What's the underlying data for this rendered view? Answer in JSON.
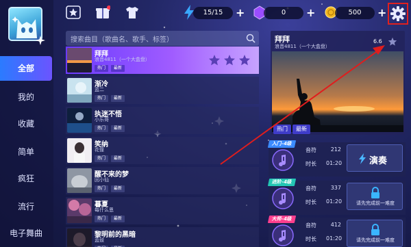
{
  "top_bar": {
    "energy": "15/15",
    "gems": "0",
    "coins": "500"
  },
  "sidebar": {
    "items": [
      {
        "label": "全部"
      },
      {
        "label": "我的"
      },
      {
        "label": "收藏"
      },
      {
        "label": "简单"
      },
      {
        "label": "疯狂"
      },
      {
        "label": "流行"
      },
      {
        "label": "电子舞曲"
      }
    ]
  },
  "search": {
    "placeholder": "搜索曲目（歌曲名、歌手、标签）"
  },
  "songs": [
    {
      "title": "拜拜",
      "artist": "浪音4811（一个大盒盘）",
      "tags": [
        "热门",
        "最新"
      ]
    },
    {
      "title": "渐冷",
      "artist": "蓝二",
      "tags": [
        "热门",
        "最新"
      ]
    },
    {
      "title": "执迷不悟",
      "artist": "小乐哥",
      "tags": [
        "热门",
        "最新"
      ]
    },
    {
      "title": "笑纳",
      "artist": "花僮",
      "tags": [
        "热门",
        "最新"
      ]
    },
    {
      "title": "醒不来的梦",
      "artist": "回小仙",
      "tags": [
        "热门",
        "最新"
      ]
    },
    {
      "title": "暮夏",
      "artist": "每什么恩",
      "tags": [
        "热门",
        "最新"
      ]
    },
    {
      "title": "黎明前的黑暗",
      "artist": "蓝鼓",
      "tags": [
        "热门",
        "最新"
      ]
    }
  ],
  "detail": {
    "title": "拜拜",
    "artist": "浪音4811（一个大盒盘）",
    "score": "6.6",
    "tags": [
      "热门",
      "最新"
    ]
  },
  "difficulties": [
    {
      "level": "入门-4级",
      "notes_label": "音符",
      "notes": "212",
      "duration_label": "时长",
      "duration": "01:20",
      "action": "演奏",
      "locked": false,
      "color": "#3b8bff"
    },
    {
      "level": "进阶-4级",
      "notes_label": "音符",
      "notes": "337",
      "duration_label": "时长",
      "duration": "01:20",
      "action": "请先完成前一难度",
      "locked": true,
      "color": "#23c6b4"
    },
    {
      "level": "大师-4级",
      "notes_label": "音符",
      "notes": "412",
      "duration_label": "时长",
      "duration": "01:20",
      "action": "请先完成前一难度",
      "locked": true,
      "color": "#ff3f8e"
    }
  ]
}
